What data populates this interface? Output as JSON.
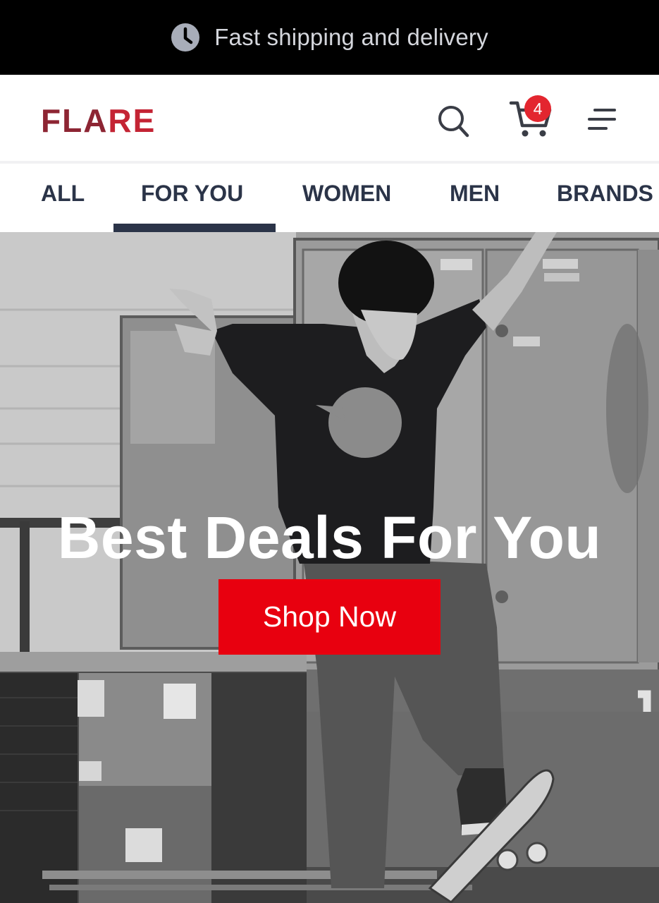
{
  "announcement": {
    "icon": "clock-icon",
    "text": "Fast shipping and delivery"
  },
  "header": {
    "logo": {
      "part1": "FLA",
      "part2": "RE"
    },
    "icons": [
      "search-icon",
      "cart-icon",
      "menu-icon"
    ],
    "cart_count": "4"
  },
  "tabs": {
    "items": [
      {
        "label": "ALL"
      },
      {
        "label": "FOR YOU"
      },
      {
        "label": "WOMEN"
      },
      {
        "label": "MEN"
      },
      {
        "label": "BRANDS"
      }
    ],
    "active": "FOR YOU"
  },
  "hero": {
    "title": "Best Deals For You",
    "cta_label": "Shop Now",
    "image": "skateboarder-photo"
  },
  "colors": {
    "announcement_bg": "#000000",
    "brand_dark": "#8d2533",
    "brand_red": "#c42434",
    "tab_text": "#2b3448",
    "badge": "#e3262f",
    "cta": "#e8000f"
  }
}
